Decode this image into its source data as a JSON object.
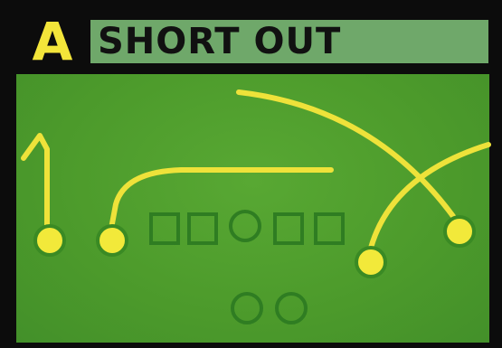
{
  "play": {
    "letter": "A",
    "title": "SHORT OUT"
  },
  "colors": {
    "route": "#eee23a",
    "player_fill": "#f2e93a",
    "player_ring": "#3a8a24",
    "lineman": "#2f7d22",
    "field": "#4f9e2e",
    "title_bar": "#6fa86a",
    "letter": "#f3e53a",
    "border": "#0c0c0c"
  }
}
